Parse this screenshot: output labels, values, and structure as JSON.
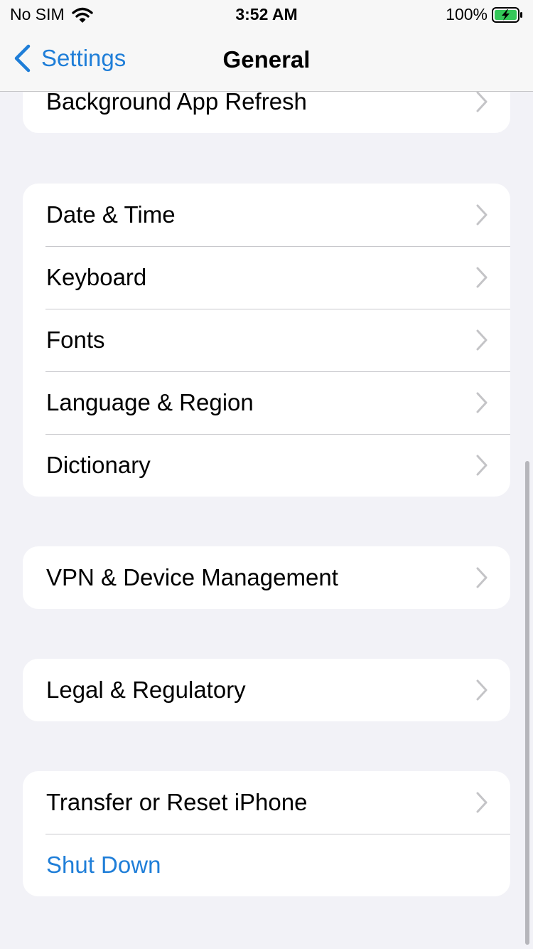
{
  "status_bar": {
    "carrier": "No SIM",
    "time": "3:52 AM",
    "battery": "100%"
  },
  "nav": {
    "back_label": "Settings",
    "title": "General"
  },
  "groups": {
    "g0": [
      "Background App Refresh"
    ],
    "g1": [
      "Date & Time",
      "Keyboard",
      "Fonts",
      "Language & Region",
      "Dictionary"
    ],
    "g2": [
      "VPN & Device Management"
    ],
    "g3": [
      "Legal & Regulatory"
    ],
    "g4": [
      "Transfer or Reset iPhone",
      "Shut Down"
    ]
  },
  "colors": {
    "accent": "#1f7ed8",
    "background": "#f2f2f7",
    "battery_fill": "#34c759"
  }
}
